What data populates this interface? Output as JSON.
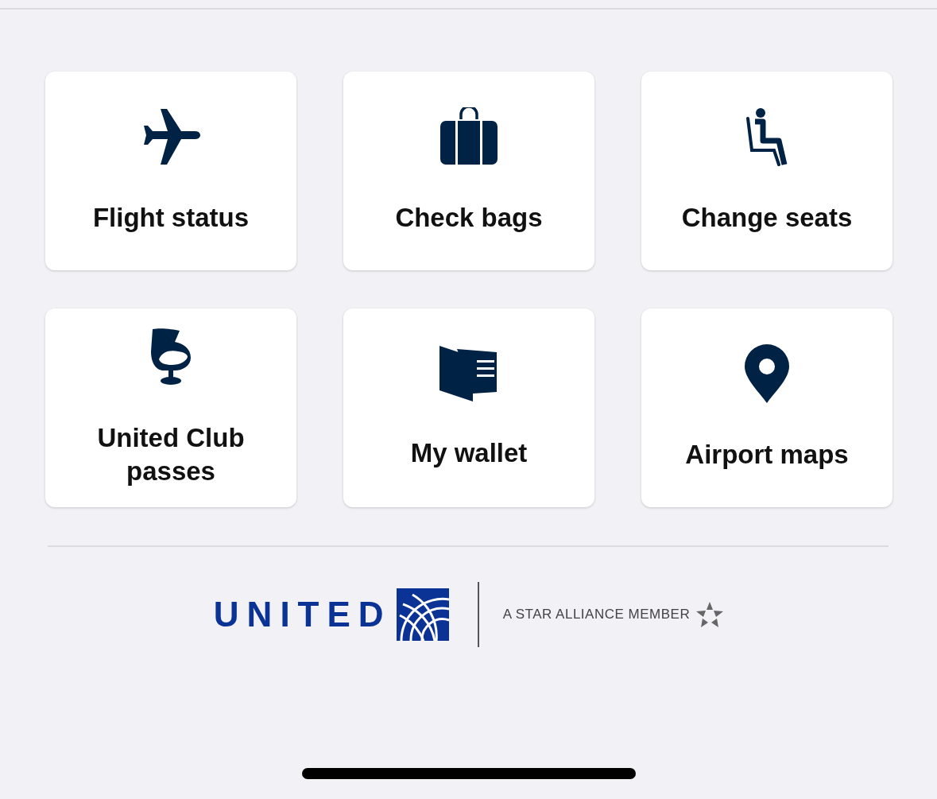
{
  "tiles": [
    {
      "kind": "plane",
      "label": "Flight status"
    },
    {
      "kind": "suitcase",
      "label": "Check bags"
    },
    {
      "kind": "seat",
      "label": "Change seats"
    },
    {
      "kind": "chair",
      "label": "United Club passes"
    },
    {
      "kind": "wallet",
      "label": "My wallet"
    },
    {
      "kind": "pin",
      "label": "Airport maps"
    }
  ],
  "footer": {
    "brand": "UNITED",
    "alliance": "A STAR ALLIANCE MEMBER"
  }
}
